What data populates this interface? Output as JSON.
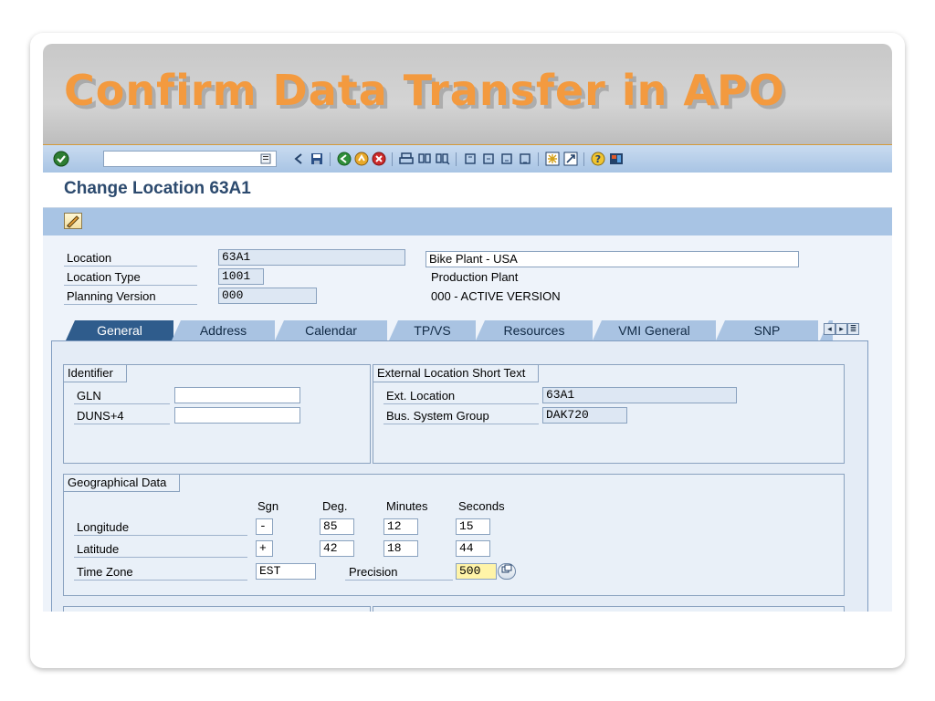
{
  "slide": {
    "title": "Confirm Data Transfer in APO"
  },
  "screen": {
    "title": "Change Location 63A1"
  },
  "toolbar": {
    "command_value": ""
  },
  "header": {
    "location_label": "Location",
    "location_value": "63A1",
    "location_desc": "Bike Plant - USA",
    "type_label": "Location Type",
    "type_value": "1001",
    "type_desc": "Production Plant",
    "version_label": "Planning Version",
    "version_value": "000",
    "version_desc": "000 - ACTIVE VERSION"
  },
  "tabs": [
    {
      "label": "General",
      "active": true
    },
    {
      "label": "Address"
    },
    {
      "label": "Calendar"
    },
    {
      "label": "TP/VS"
    },
    {
      "label": "Resources"
    },
    {
      "label": "VMI General"
    },
    {
      "label": "SNP"
    }
  ],
  "identifier": {
    "title": "Identifier",
    "gln_label": "GLN",
    "gln_value": "",
    "duns_label": "DUNS+4",
    "duns_value": ""
  },
  "external": {
    "title": "External Location Short Text",
    "ext_label": "Ext. Location",
    "ext_value": "63A1",
    "bus_label": "Bus. System Group",
    "bus_value": "DAK720"
  },
  "geo": {
    "title": "Geographical Data",
    "col_sgn": "Sgn",
    "col_deg": "Deg.",
    "col_min": "Minutes",
    "col_sec": "Seconds",
    "longitude_label": "Longitude",
    "longitude": {
      "sgn": "-",
      "deg": "85",
      "min": "12",
      "sec": "15"
    },
    "latitude_label": "Latitude",
    "latitude": {
      "sgn": "+",
      "deg": "42",
      "min": "18",
      "sec": "44"
    },
    "timezone_label": "Time Zone",
    "timezone_value": "EST",
    "precision_label": "Precision",
    "precision_value": "500"
  },
  "colors": {
    "title_orange": "#f39a3f",
    "toolbar_blue": "#a8c4e4",
    "active_tab": "#2f5c8c",
    "screen_title": "#2c4a6e"
  }
}
